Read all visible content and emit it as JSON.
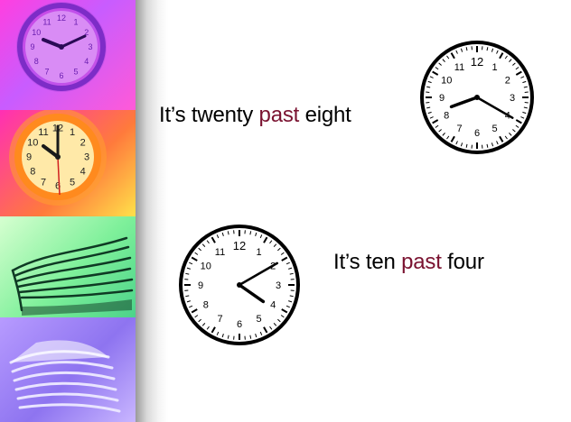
{
  "lessons": [
    {
      "prefix": "It’s twenty ",
      "keyword": "past",
      "suffix": " eight",
      "time": {
        "hour": 8,
        "minute": 20
      }
    },
    {
      "prefix": "It’s ten ",
      "keyword": "past",
      "suffix": " four",
      "time": {
        "hour": 4,
        "minute": 10
      }
    }
  ],
  "clock_numerals": [
    "12",
    "1",
    "2",
    "3",
    "4",
    "5",
    "6",
    "7",
    "8",
    "9",
    "10",
    "11"
  ],
  "decor_clock_numerals": [
    "12",
    "1",
    "2",
    "3",
    "4",
    "5",
    "6",
    "7",
    "8",
    "9",
    "10",
    "11"
  ],
  "colors": {
    "keyword": "#7a1230",
    "text": "#000000"
  },
  "icons": [
    "wall-clock-icon",
    "alarm-clock-icon",
    "book-stack-icon",
    "paper-stack-icon"
  ]
}
